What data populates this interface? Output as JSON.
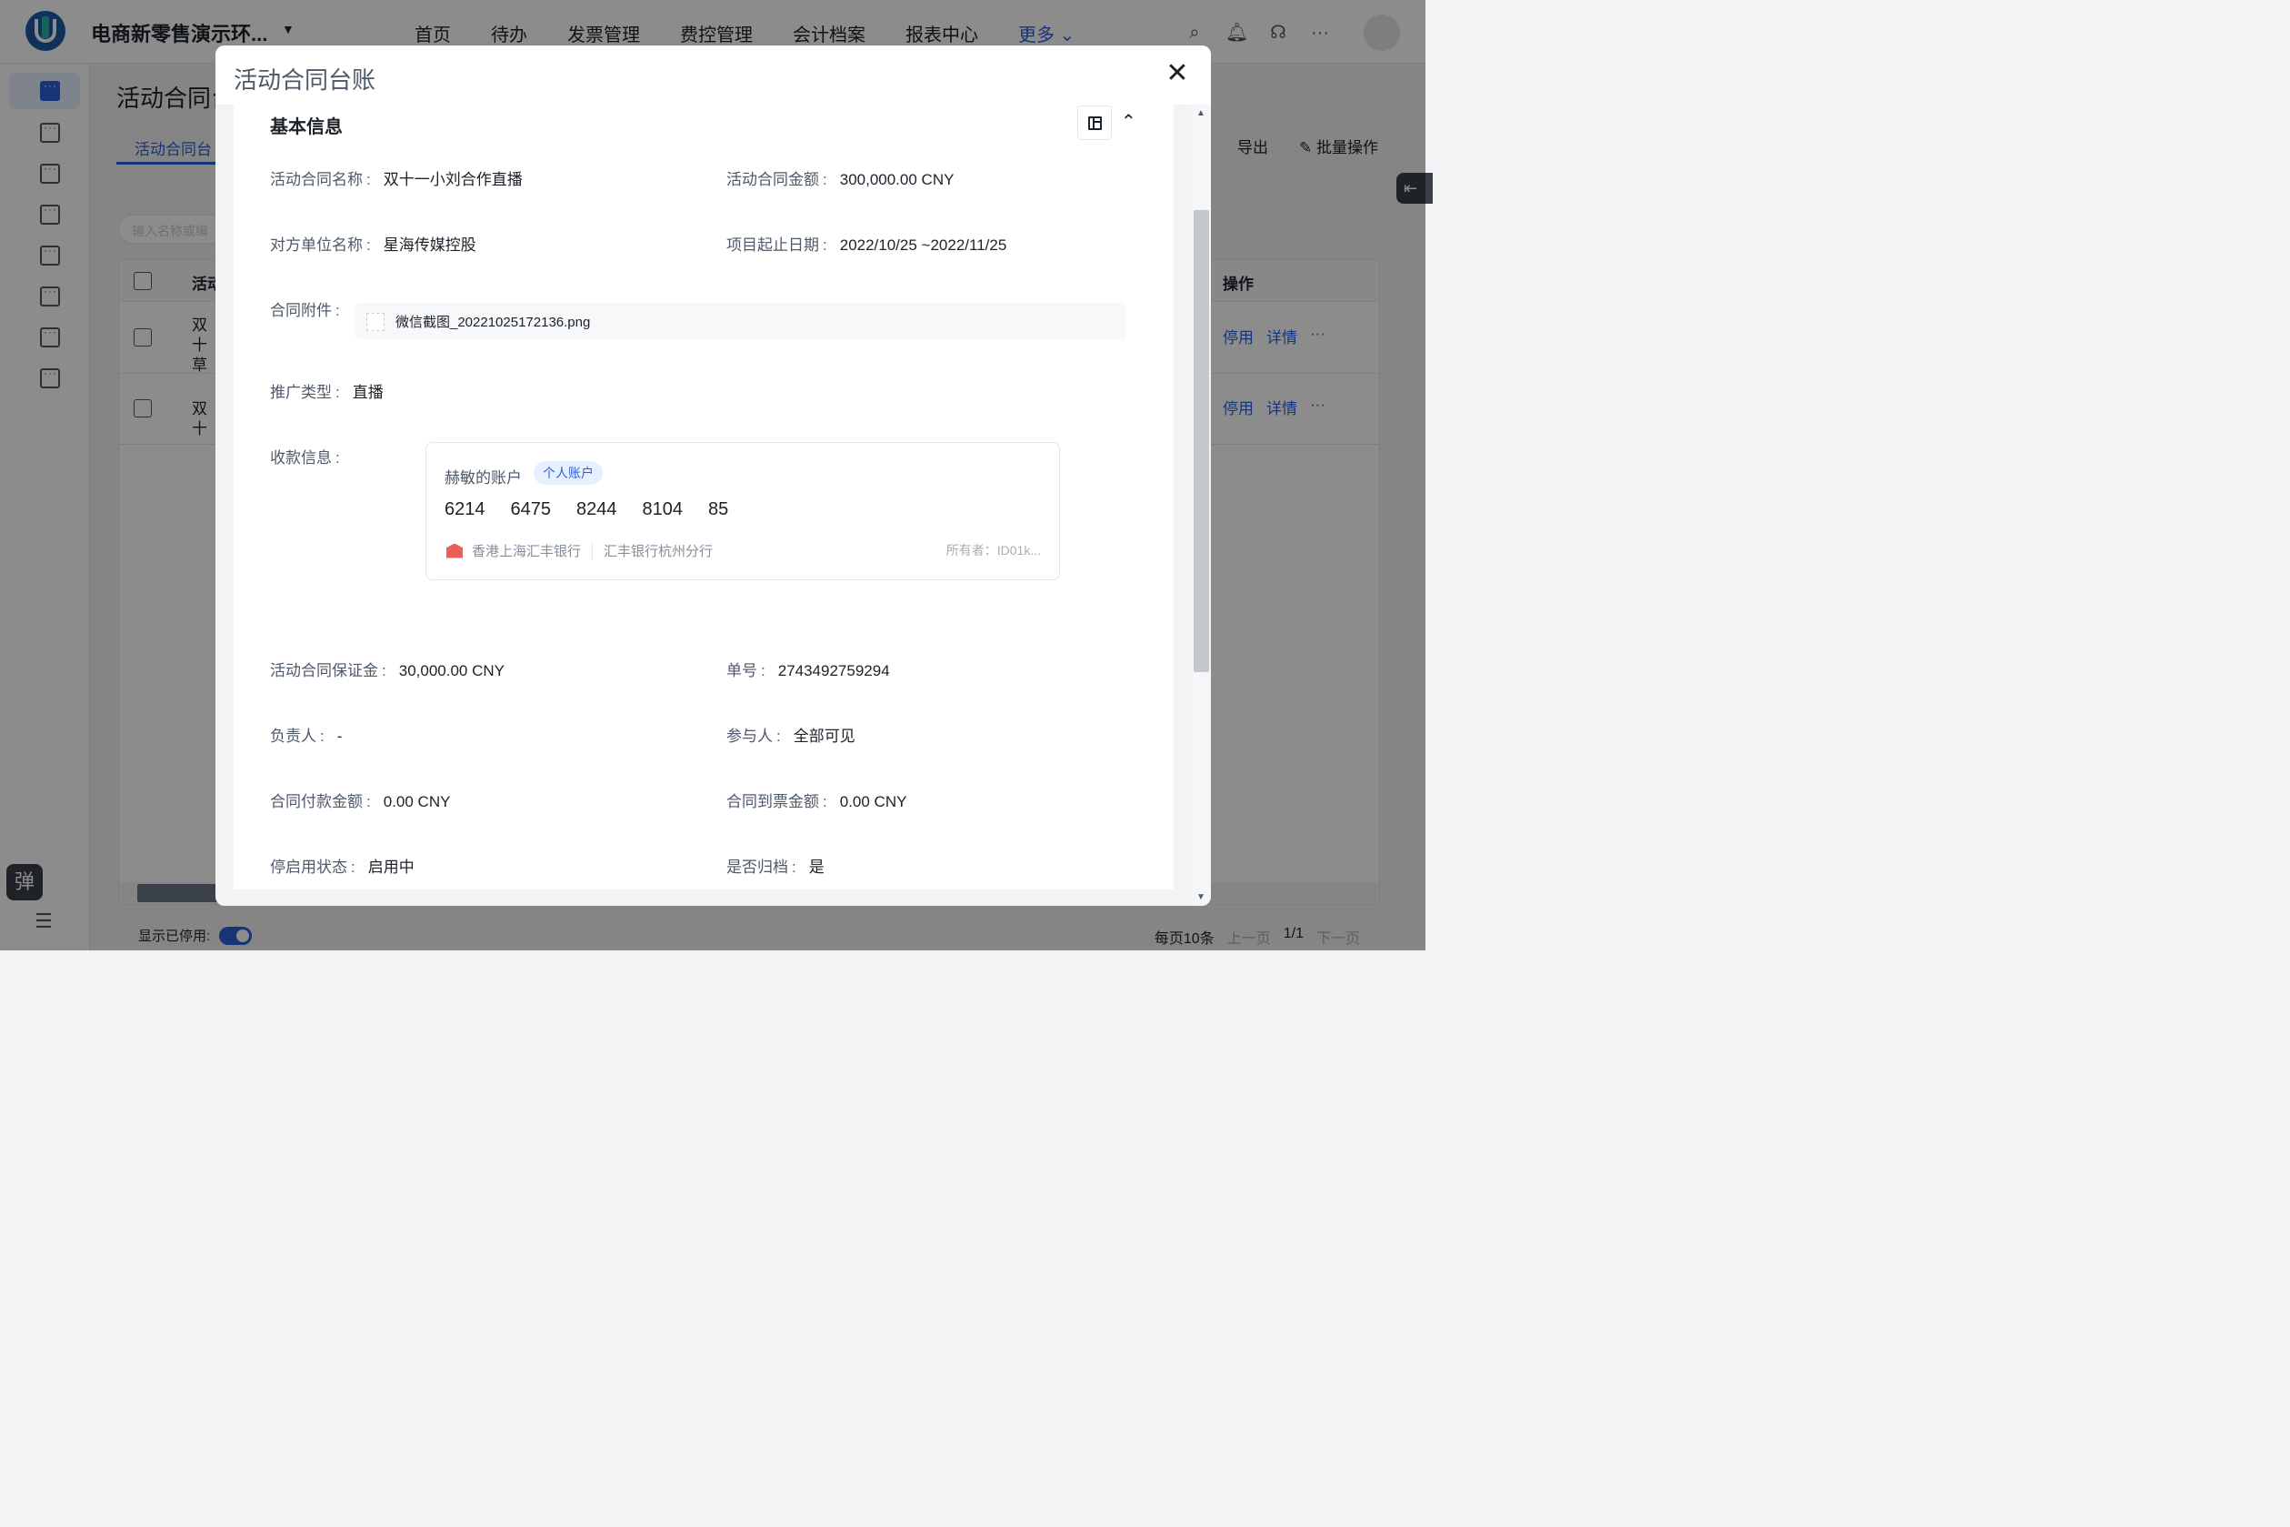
{
  "topnav": {
    "org_name": "电商新零售演示环...",
    "links": [
      "首页",
      "待办",
      "发票管理",
      "费控管理",
      "会计档案",
      "报表中心"
    ],
    "more_label": "更多"
  },
  "sidebar": {
    "float_label": "弹"
  },
  "page": {
    "title": "活动合同台",
    "tab_label": "活动合同台",
    "export_label": "导出",
    "batch_label": "批量操作",
    "search_placeholder": "输入名称或编",
    "table": {
      "header_name": "活动",
      "header_ops": "操作",
      "rows": [
        {
          "name": "双十草",
          "op1": "停用",
          "op2": "详情",
          "op3": "···"
        },
        {
          "name": "双十",
          "op1": "停用",
          "op2": "详情",
          "op3": "···"
        }
      ]
    },
    "footer": {
      "show_disabled": "显示已停用:",
      "page_size": "每页10条",
      "prev": "上一页",
      "page_info": "1/1",
      "next": "下一页"
    }
  },
  "modal": {
    "title": "活动合同台账",
    "section_title": "基本信息",
    "fields": {
      "contract_name": {
        "label": "活动合同名称",
        "value": "双十一小刘合作直播"
      },
      "contract_amount": {
        "label": "活动合同金额",
        "value": "300,000.00 CNY"
      },
      "counterparty": {
        "label": "对方单位名称",
        "value": "星海传媒控股"
      },
      "project_dates": {
        "label": "项目起止日期",
        "value": "2022/10/25 ~2022/11/25"
      },
      "attachment": {
        "label": "合同附件",
        "value": "微信截图_20221025172136.png"
      },
      "promo_type": {
        "label": "推广类型",
        "value": "直播"
      },
      "payment_info": {
        "label": "收款信息"
      },
      "deposit": {
        "label": "活动合同保证金",
        "value": "30,000.00 CNY"
      },
      "order_no": {
        "label": "单号",
        "value": "2743492759294"
      },
      "owner": {
        "label": "负责人",
        "value": "-"
      },
      "participants": {
        "label": "参与人",
        "value": "全部可见"
      },
      "paid_amount": {
        "label": "合同付款金额",
        "value": "0.00 CNY"
      },
      "invoiced_amount": {
        "label": "合同到票金额",
        "value": "0.00 CNY"
      },
      "status": {
        "label": "停启用状态",
        "value": "启用中"
      },
      "archived": {
        "label": "是否归档",
        "value": "是"
      }
    },
    "bank_card": {
      "account_name": "赫敏的账户",
      "account_type": "个人账户",
      "number_groups": [
        "6214",
        "6475",
        "8244",
        "8104",
        "85"
      ],
      "bank": "香港上海汇丰银行",
      "branch": "汇丰银行杭州分行",
      "owner_id": "所有者：ID01k..."
    }
  },
  "colors": {
    "accent": "#2b5fd9",
    "overlay": "rgba(0,0,0,0.45)",
    "tag_bg": "#e8f0ff",
    "bank_icon": "#e8605a"
  }
}
